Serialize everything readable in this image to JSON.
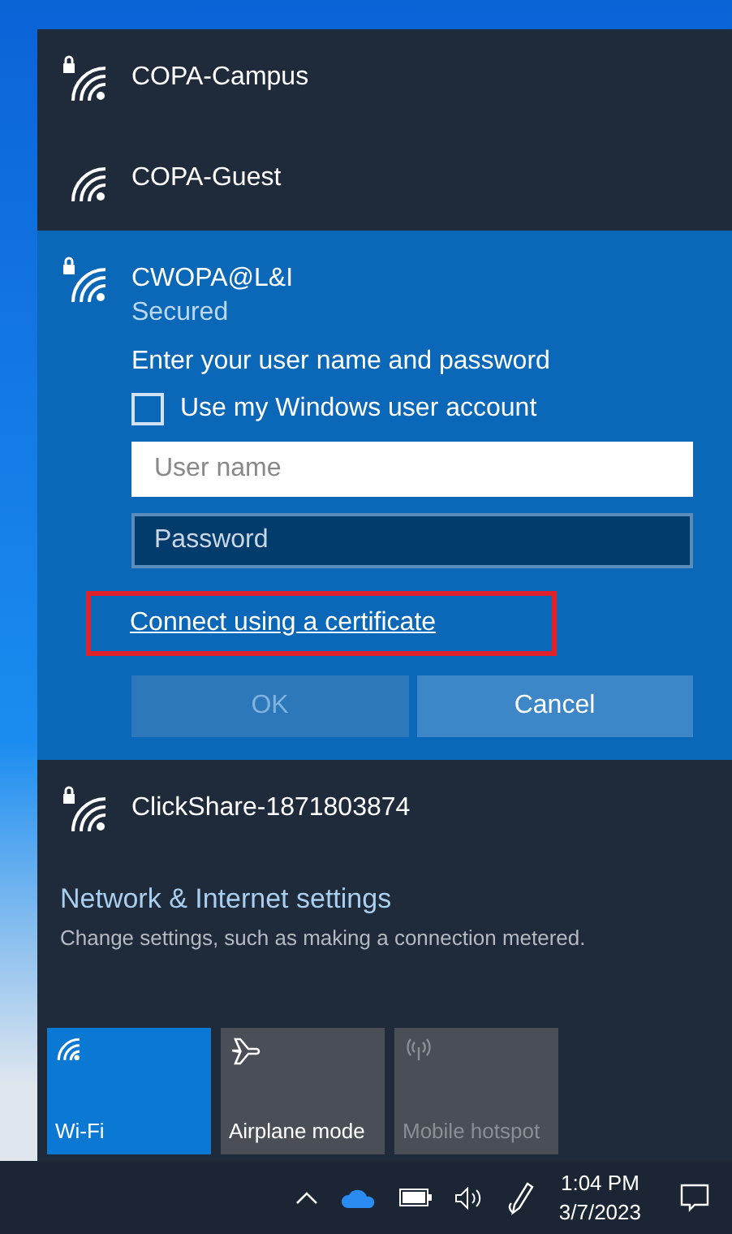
{
  "networks": [
    {
      "name": "COPA-Campus",
      "secured": true,
      "expanded": false
    },
    {
      "name": "COPA-Guest",
      "secured": false,
      "expanded": false
    },
    {
      "name": "CWOPA@L&I",
      "secured": true,
      "expanded": true,
      "status": "Secured",
      "prompt": "Enter your user name and password",
      "checkbox": {
        "label": "Use my Windows user account",
        "checked": false
      },
      "username": {
        "placeholder": "User name"
      },
      "password": {
        "placeholder": "Password"
      },
      "link": "Connect using a certificate",
      "buttons": [
        {
          "label": "OK",
          "disabled": true
        },
        {
          "label": "Cancel",
          "disabled": false
        }
      ]
    },
    {
      "name": "ClickShare-1871803874",
      "secured": true,
      "expanded": false
    }
  ],
  "settings": {
    "title": "Network & Internet settings",
    "subtitle": "Change settings, such as making a connection metered."
  },
  "tiles": [
    {
      "kind": "wifi",
      "label": "Wi-Fi",
      "on": true,
      "disabled": false
    },
    {
      "kind": "airplane",
      "label": "Airplane mode",
      "on": false,
      "disabled": false
    },
    {
      "kind": "hotspot",
      "label": "Mobile hotspot",
      "on": false,
      "disabled": true
    }
  ],
  "taskbar": {
    "time": "1:04 PM",
    "date": "3/7/2023"
  }
}
